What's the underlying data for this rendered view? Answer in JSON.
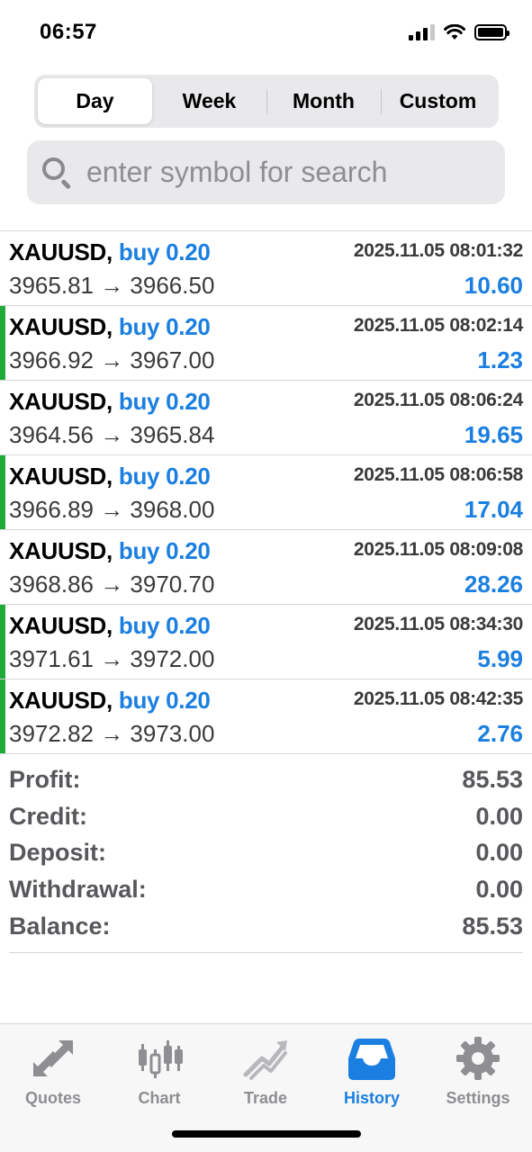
{
  "status_bar": {
    "time": "06:57"
  },
  "period_tabs": [
    {
      "label": "Day",
      "active": true
    },
    {
      "label": "Week",
      "active": false
    },
    {
      "label": "Month",
      "active": false
    },
    {
      "label": "Custom",
      "active": false
    }
  ],
  "search": {
    "placeholder": "enter symbol for search",
    "value": ""
  },
  "deals": [
    {
      "symbol": "XAUUSD,",
      "direction": "buy 0.20",
      "time": "2025.11.05 08:01:32",
      "prices": "3965.81 → 3966.50",
      "profit": "10.60",
      "marker": false
    },
    {
      "symbol": "XAUUSD,",
      "direction": "buy 0.20",
      "time": "2025.11.05 08:02:14",
      "prices": "3966.92 → 3967.00",
      "profit": "1.23",
      "marker": true
    },
    {
      "symbol": "XAUUSD,",
      "direction": "buy 0.20",
      "time": "2025.11.05 08:06:24",
      "prices": "3964.56 → 3965.84",
      "profit": "19.65",
      "marker": false
    },
    {
      "symbol": "XAUUSD,",
      "direction": "buy 0.20",
      "time": "2025.11.05 08:06:58",
      "prices": "3966.89 → 3968.00",
      "profit": "17.04",
      "marker": true
    },
    {
      "symbol": "XAUUSD,",
      "direction": "buy 0.20",
      "time": "2025.11.05 08:09:08",
      "prices": "3968.86 → 3970.70",
      "profit": "28.26",
      "marker": false
    },
    {
      "symbol": "XAUUSD,",
      "direction": "buy 0.20",
      "time": "2025.11.05 08:34:30",
      "prices": "3971.61 → 3972.00",
      "profit": "5.99",
      "marker": true
    },
    {
      "symbol": "XAUUSD,",
      "direction": "buy 0.20",
      "time": "2025.11.05 08:42:35",
      "prices": "3972.82 → 3973.00",
      "profit": "2.76",
      "marker": true
    }
  ],
  "summary": [
    {
      "label": "Profit:",
      "value": "85.53"
    },
    {
      "label": "Credit:",
      "value": "0.00"
    },
    {
      "label": "Deposit:",
      "value": "0.00"
    },
    {
      "label": "Withdrawal:",
      "value": "0.00"
    },
    {
      "label": "Balance:",
      "value": "85.53"
    }
  ],
  "tabbar": [
    {
      "label": "Quotes",
      "icon": "quotes-arrows-icon",
      "active": false
    },
    {
      "label": "Chart",
      "icon": "candlestick-chart-icon",
      "active": false
    },
    {
      "label": "Trade",
      "icon": "trade-trend-icon",
      "active": false
    },
    {
      "label": "History",
      "icon": "history-tray-icon",
      "active": true
    },
    {
      "label": "Settings",
      "icon": "settings-gear-icon",
      "active": false
    }
  ],
  "colors": {
    "accent": "#1a7fe0",
    "marker_green": "#1faa3a",
    "inactive_tab": "#8e8e93",
    "text_gray": "#3a3a3c"
  }
}
